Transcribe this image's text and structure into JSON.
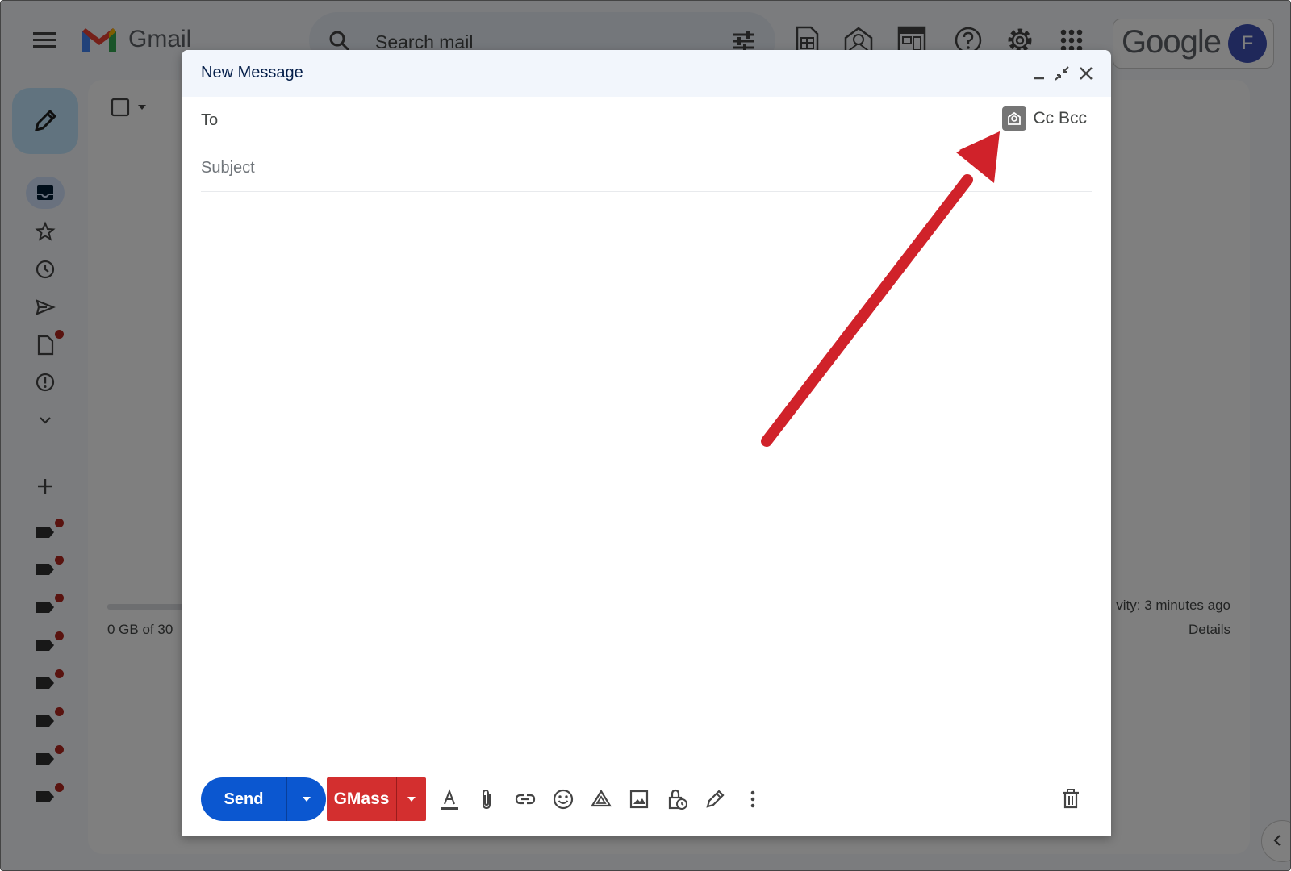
{
  "app": {
    "name": "Gmail"
  },
  "search": {
    "placeholder": "Search mail"
  },
  "account": {
    "brand": "Google",
    "avatar_initial": "F"
  },
  "storage": {
    "usage_text": "0 GB of 30",
    "activity_text": "vity: 3 minutes ago",
    "details_label": "Details"
  },
  "compose": {
    "title": "New Message",
    "to_label": "To",
    "cc_bcc_label": "Cc Bcc",
    "subject_placeholder": "Subject",
    "send_label": "Send",
    "gmass_label": "GMass"
  },
  "colors": {
    "send_blue": "#0b57d0",
    "gmass_red": "#d32f2f",
    "arrow_red": "#d0222a",
    "compose_btn": "#c2e7ff"
  },
  "icons": {
    "toolbar": [
      "sheets-icon",
      "mail-merge-icon",
      "calendar-grid-icon",
      "help-icon",
      "settings-icon",
      "apps-icon"
    ],
    "sidebar": [
      "inbox-icon",
      "star-icon",
      "clock-icon",
      "send-icon",
      "draft-icon",
      "spam-icon",
      "chevron-down-icon"
    ],
    "format_bar": [
      "text-format-icon",
      "attach-icon",
      "link-icon",
      "emoji-icon",
      "drive-icon",
      "image-icon",
      "confidential-icon",
      "signature-icon",
      "more-icon"
    ]
  }
}
